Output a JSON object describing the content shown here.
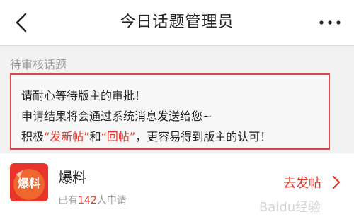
{
  "header": {
    "title": "今日话题管理员",
    "back_icon": "chevron-left-icon",
    "more_icon": "more-horizontal-icon"
  },
  "section": {
    "label": "待审核话题"
  },
  "notice": {
    "line1": "请耐心等待版主的审批！",
    "line2": "申请结果将会通过系统消息发送给您~",
    "line3_a": "积极",
    "line3_b": "“发新帖”",
    "line3_c": "和",
    "line3_d": "“回帖”",
    "line3_e": "，更容易得到版主的认可！"
  },
  "topic": {
    "thumb_text": "爆料",
    "name": "爆料",
    "meta_prefix": "已有",
    "count": "142",
    "meta_suffix": "人申请",
    "action_label": "去发帖"
  },
  "watermark": {
    "text": "Baidu经验"
  },
  "colors": {
    "accent": "#e0362c",
    "border": "#d9454b"
  }
}
